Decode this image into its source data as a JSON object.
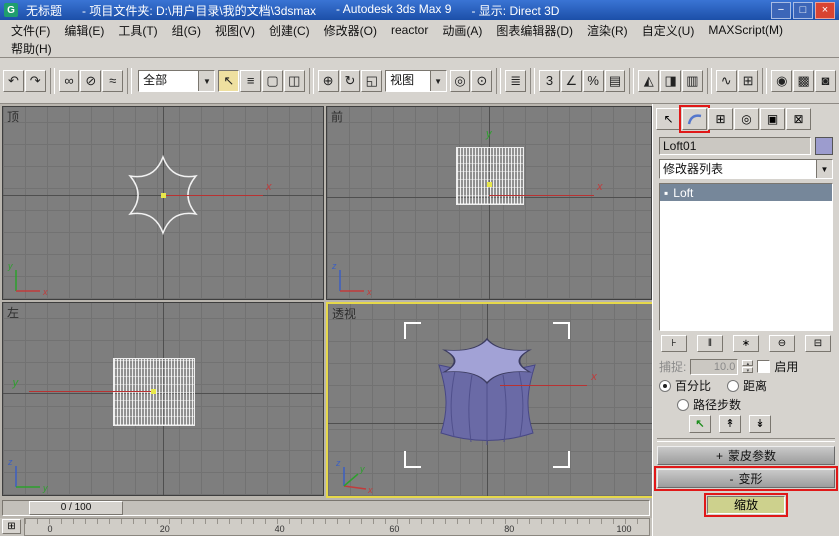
{
  "window": {
    "icon_letter": "G",
    "title_parts": [
      "无标题",
      "- 项目文件夹: D:\\用户目录\\我的文档\\3dsmax",
      "- Autodesk 3ds Max 9",
      "- 显示: Direct 3D"
    ],
    "buttons": {
      "minimize": "−",
      "maximize": "□",
      "close": "×"
    }
  },
  "menu": {
    "items": [
      "文件(F)",
      "编辑(E)",
      "工具(T)",
      "组(G)",
      "视图(V)",
      "创建(C)",
      "修改器(O)",
      "reactor",
      "动画(A)",
      "图表编辑器(D)",
      "渲染(R)",
      "自定义(U)",
      "MAXScript(M)",
      "帮助(H)"
    ]
  },
  "toolbar": {
    "selection_filter": {
      "value": "全部",
      "arrow": "▼"
    },
    "coord_system": {
      "value": "视图",
      "arrow": "▼"
    },
    "icons": {
      "undo": "↶",
      "redo": "↷",
      "select_link": "∞",
      "unlink": "⊘",
      "bind_spacewarp": "≈",
      "select": "↖",
      "select_by_name": "≡",
      "rect_region": "▢",
      "crossing": "◫",
      "move": "⊕",
      "rotate": "↻",
      "scale": "◱",
      "pivot_center": "◎",
      "manipulate": "⊙",
      "kbd_override": "≣",
      "snap_3d": "3",
      "snap_angle": "∠",
      "snap_percent": "%",
      "named_sets": "▤",
      "mirror": "◭",
      "align": "◨",
      "layers": "▥",
      "curve_editor": "∿",
      "schematic": "⊞",
      "material": "◉",
      "render_setup": "▩",
      "render": "◙"
    }
  },
  "viewports": {
    "top": {
      "label": "顶"
    },
    "front": {
      "label": "前"
    },
    "left": {
      "label": "左"
    },
    "perspective": {
      "label": "透视"
    },
    "axis": {
      "x": "x",
      "y": "y",
      "z": "z"
    }
  },
  "timeline": {
    "slider_label": "0 / 100",
    "ticks": [
      "0",
      "20",
      "40",
      "60",
      "80",
      "100"
    ],
    "mini_curve_editor_icon": "⊞"
  },
  "command_panel": {
    "tabs": {
      "create": "↖",
      "hierarchy": "⊞",
      "motion": "◎",
      "display": "▣",
      "utilities": "⊠"
    },
    "object_name": "Loft01",
    "modifier_list_label": "修改器列表",
    "dropdown_arrow": "▼",
    "stack": {
      "item_icon": "▪",
      "item_label": "Loft"
    },
    "stack_buttons": {
      "pin": "⊦",
      "show_end_result": "‖",
      "make_unique": "∗",
      "remove_modifier": "⊖",
      "configure_sets": "⊟"
    },
    "path_params": {
      "snap_label": "捕捉:",
      "snap_value": "10.0",
      "spinner_up": "▴",
      "spinner_down": "▾",
      "enable_label": "启用",
      "percent_label": "百分比",
      "distance_label": "距离",
      "path_steps_label": "路径步数",
      "buttons": {
        "pick_shape": "↖",
        "prev_shape": "↟",
        "next_shape": "↡"
      }
    },
    "rollouts": {
      "skin_sign": "+",
      "skin_label": "蒙皮参数",
      "deform_sign": "-",
      "deform_label": "变形"
    },
    "scale_button_label": "缩放"
  }
}
